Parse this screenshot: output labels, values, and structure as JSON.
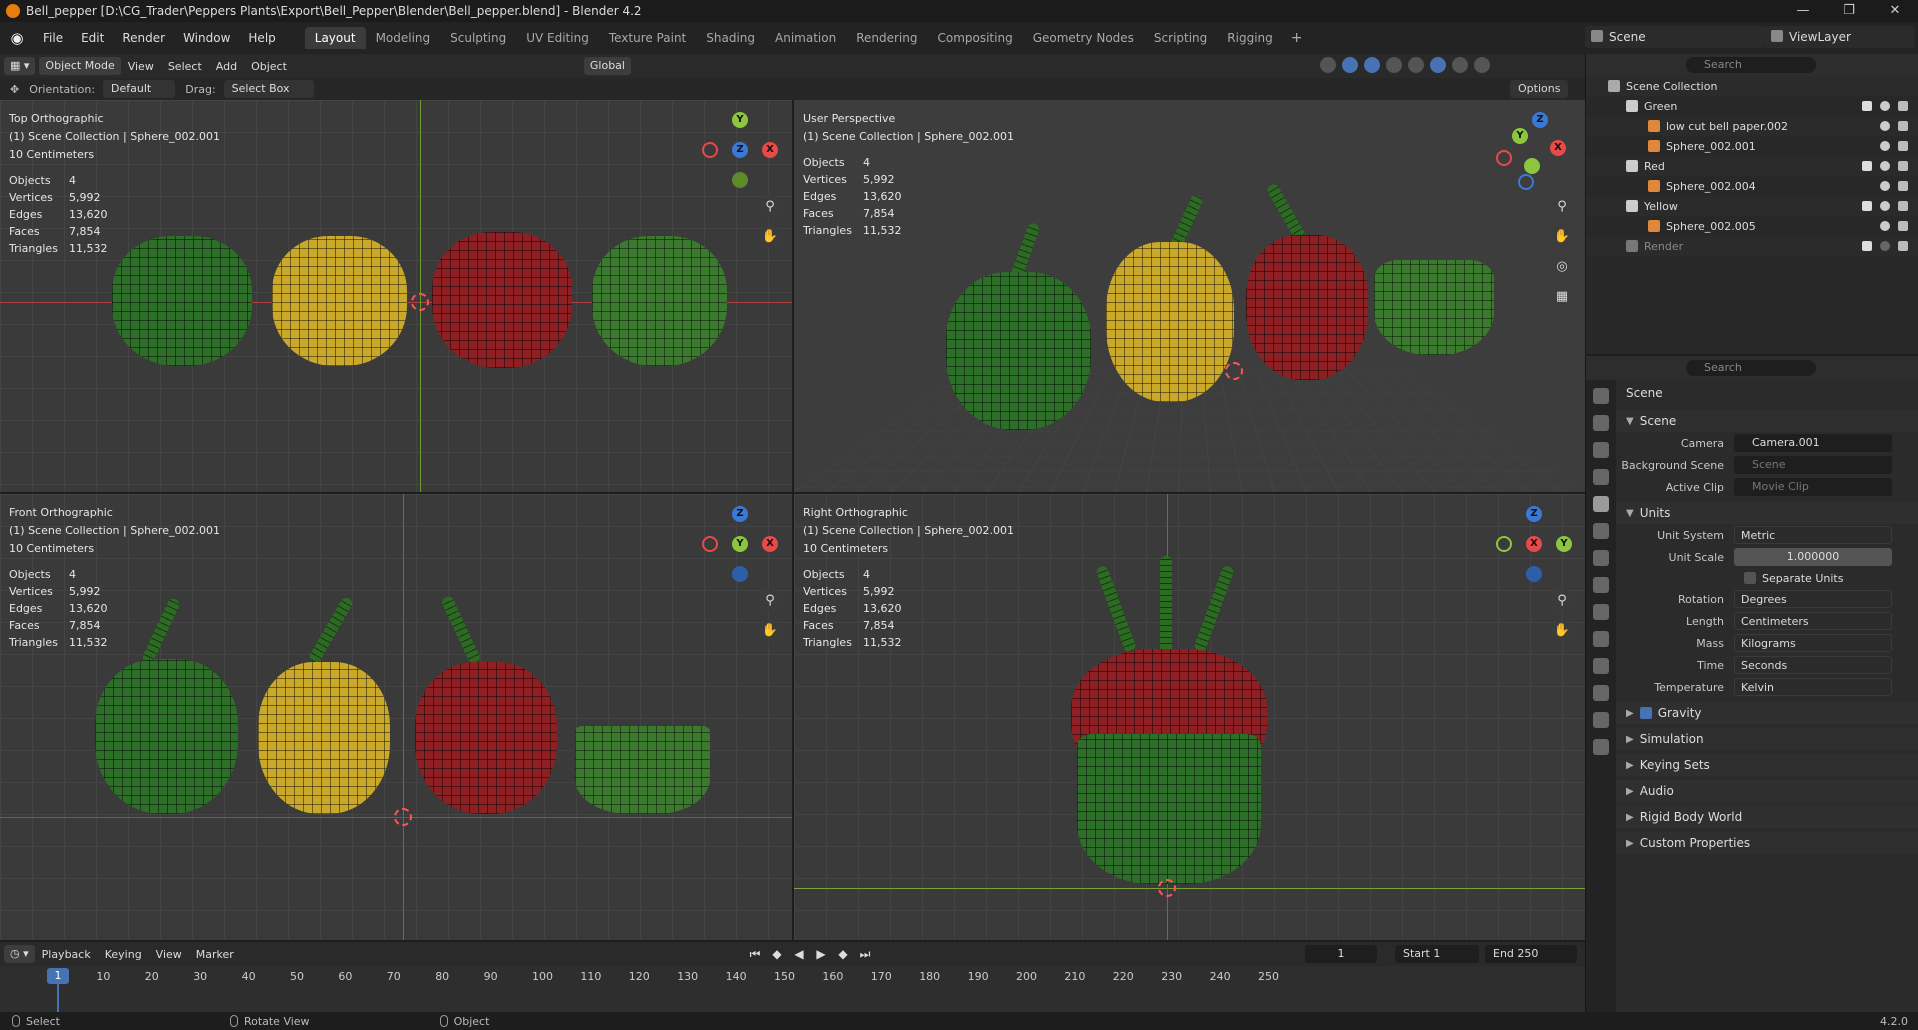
{
  "window": {
    "title": "Bell_pepper [D:\\CG_Trader\\Peppers Plants\\Export\\Bell_Pepper\\Blender\\Bell_pepper.blend] - Blender 4.2",
    "controls": [
      "—",
      "❐",
      "✕"
    ]
  },
  "menu": [
    "File",
    "Edit",
    "Render",
    "Window",
    "Help"
  ],
  "workspaces": [
    "Layout",
    "Modeling",
    "Sculpting",
    "UV Editing",
    "Texture Paint",
    "Shading",
    "Animation",
    "Rendering",
    "Compositing",
    "Geometry Nodes",
    "Scripting",
    "Rigging"
  ],
  "workspace_add": "+",
  "scene": {
    "name": "Scene",
    "view_layer": "ViewLayer"
  },
  "viewport_header": {
    "mode": "Object Mode",
    "menus": [
      "View",
      "Select",
      "Add",
      "Object"
    ],
    "transform": "Global",
    "orientation_label": "Orientation:",
    "orientation_value": "Default",
    "drag_label": "Drag:",
    "drag_value": "Select Box",
    "options": "Options"
  },
  "stats": {
    "objects_label": "Objects",
    "objects": "4",
    "vertices_label": "Vertices",
    "vertices": "5,992",
    "edges_label": "Edges",
    "edges": "13,620",
    "faces_label": "Faces",
    "faces": "7,854",
    "triangles_label": "Triangles",
    "triangles": "11,532"
  },
  "viewports": {
    "top": {
      "name": "Top Orthographic",
      "collection": "(1) Scene Collection | Sphere_002.001",
      "scale": "10 Centimeters"
    },
    "persp": {
      "name": "User Perspective",
      "collection": "(1) Scene Collection | Sphere_002.001"
    },
    "front": {
      "name": "Front Orthographic",
      "collection": "(1) Scene Collection | Sphere_002.001",
      "scale": "10 Centimeters"
    },
    "right": {
      "name": "Right Orthographic",
      "collection": "(1) Scene Collection | Sphere_002.001",
      "scale": "10 Centimeters"
    }
  },
  "axes": {
    "x": "X",
    "y": "Y",
    "z": "Z"
  },
  "outliner": {
    "search_placeholder": "Search",
    "root": "Scene Collection",
    "items": [
      {
        "label": "Green"
      },
      {
        "label": "low cut bell paper.002"
      },
      {
        "label": "Sphere_002.001"
      },
      {
        "label": "Red"
      },
      {
        "label": "Sphere_002.004"
      },
      {
        "label": "Yellow"
      },
      {
        "label": "Sphere_002.005"
      },
      {
        "label": "Render"
      }
    ]
  },
  "properties": {
    "search_placeholder": "Search",
    "breadcrumb": "Scene",
    "panel_scene": "Scene",
    "camera_label": "Camera",
    "camera_value": "Camera.001",
    "bg_scene_label": "Background Scene",
    "bg_scene_value": "Scene",
    "clip_label": "Active Clip",
    "clip_value": "Movie Clip",
    "panel_units": "Units",
    "unit_system_label": "Unit System",
    "unit_system_value": "Metric",
    "unit_scale_label": "Unit Scale",
    "unit_scale_value": "1.000000",
    "separate_units": "Separate Units",
    "rotation_label": "Rotation",
    "rotation_value": "Degrees",
    "length_label": "Length",
    "length_value": "Centimeters",
    "mass_label": "Mass",
    "mass_value": "Kilograms",
    "time_label": "Time",
    "time_value": "Seconds",
    "temp_label": "Temperature",
    "temp_value": "Kelvin",
    "panels": [
      "Gravity",
      "Simulation",
      "Keying Sets",
      "Audio",
      "Rigid Body World",
      "Custom Properties"
    ]
  },
  "timeline": {
    "menus": [
      "Playback",
      "Keying",
      "View",
      "Marker"
    ],
    "current_frame": "1",
    "start_label": "Start",
    "start": "1",
    "end_label": "End",
    "end": "250",
    "ticks": [
      "10",
      "20",
      "30",
      "40",
      "50",
      "60",
      "70",
      "80",
      "90",
      "100",
      "110",
      "120",
      "130",
      "140",
      "150",
      "160",
      "170",
      "180",
      "190",
      "200",
      "210",
      "220",
      "230",
      "240",
      "250"
    ]
  },
  "statusbar": {
    "select": "Select",
    "rotate": "Rotate View",
    "object": "Object",
    "version": "4.2.0"
  }
}
